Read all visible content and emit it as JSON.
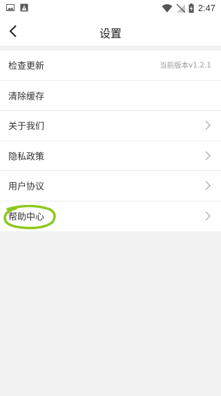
{
  "status_bar": {
    "time": "2:47",
    "left_icons": [
      "image-icon",
      "alert-icon"
    ],
    "right_icons": [
      "wifi-icon",
      "signal-off-icon",
      "battery-charging-icon"
    ]
  },
  "nav": {
    "title": "设置",
    "back_icon": "back-arrow-icon"
  },
  "settings": {
    "items": [
      {
        "label": "检查更新",
        "value": "当前版本v1.2.1",
        "chevron": false
      },
      {
        "label": "清除缓存",
        "value": "",
        "chevron": false
      },
      {
        "label": "关于我们",
        "value": "",
        "chevron": true
      },
      {
        "label": "隐私政策",
        "value": "",
        "chevron": true
      },
      {
        "label": "用户协议",
        "value": "",
        "chevron": true
      },
      {
        "label": "帮助中心",
        "value": "",
        "chevron": true
      }
    ]
  },
  "annotation": {
    "color": "#8cc81e"
  }
}
